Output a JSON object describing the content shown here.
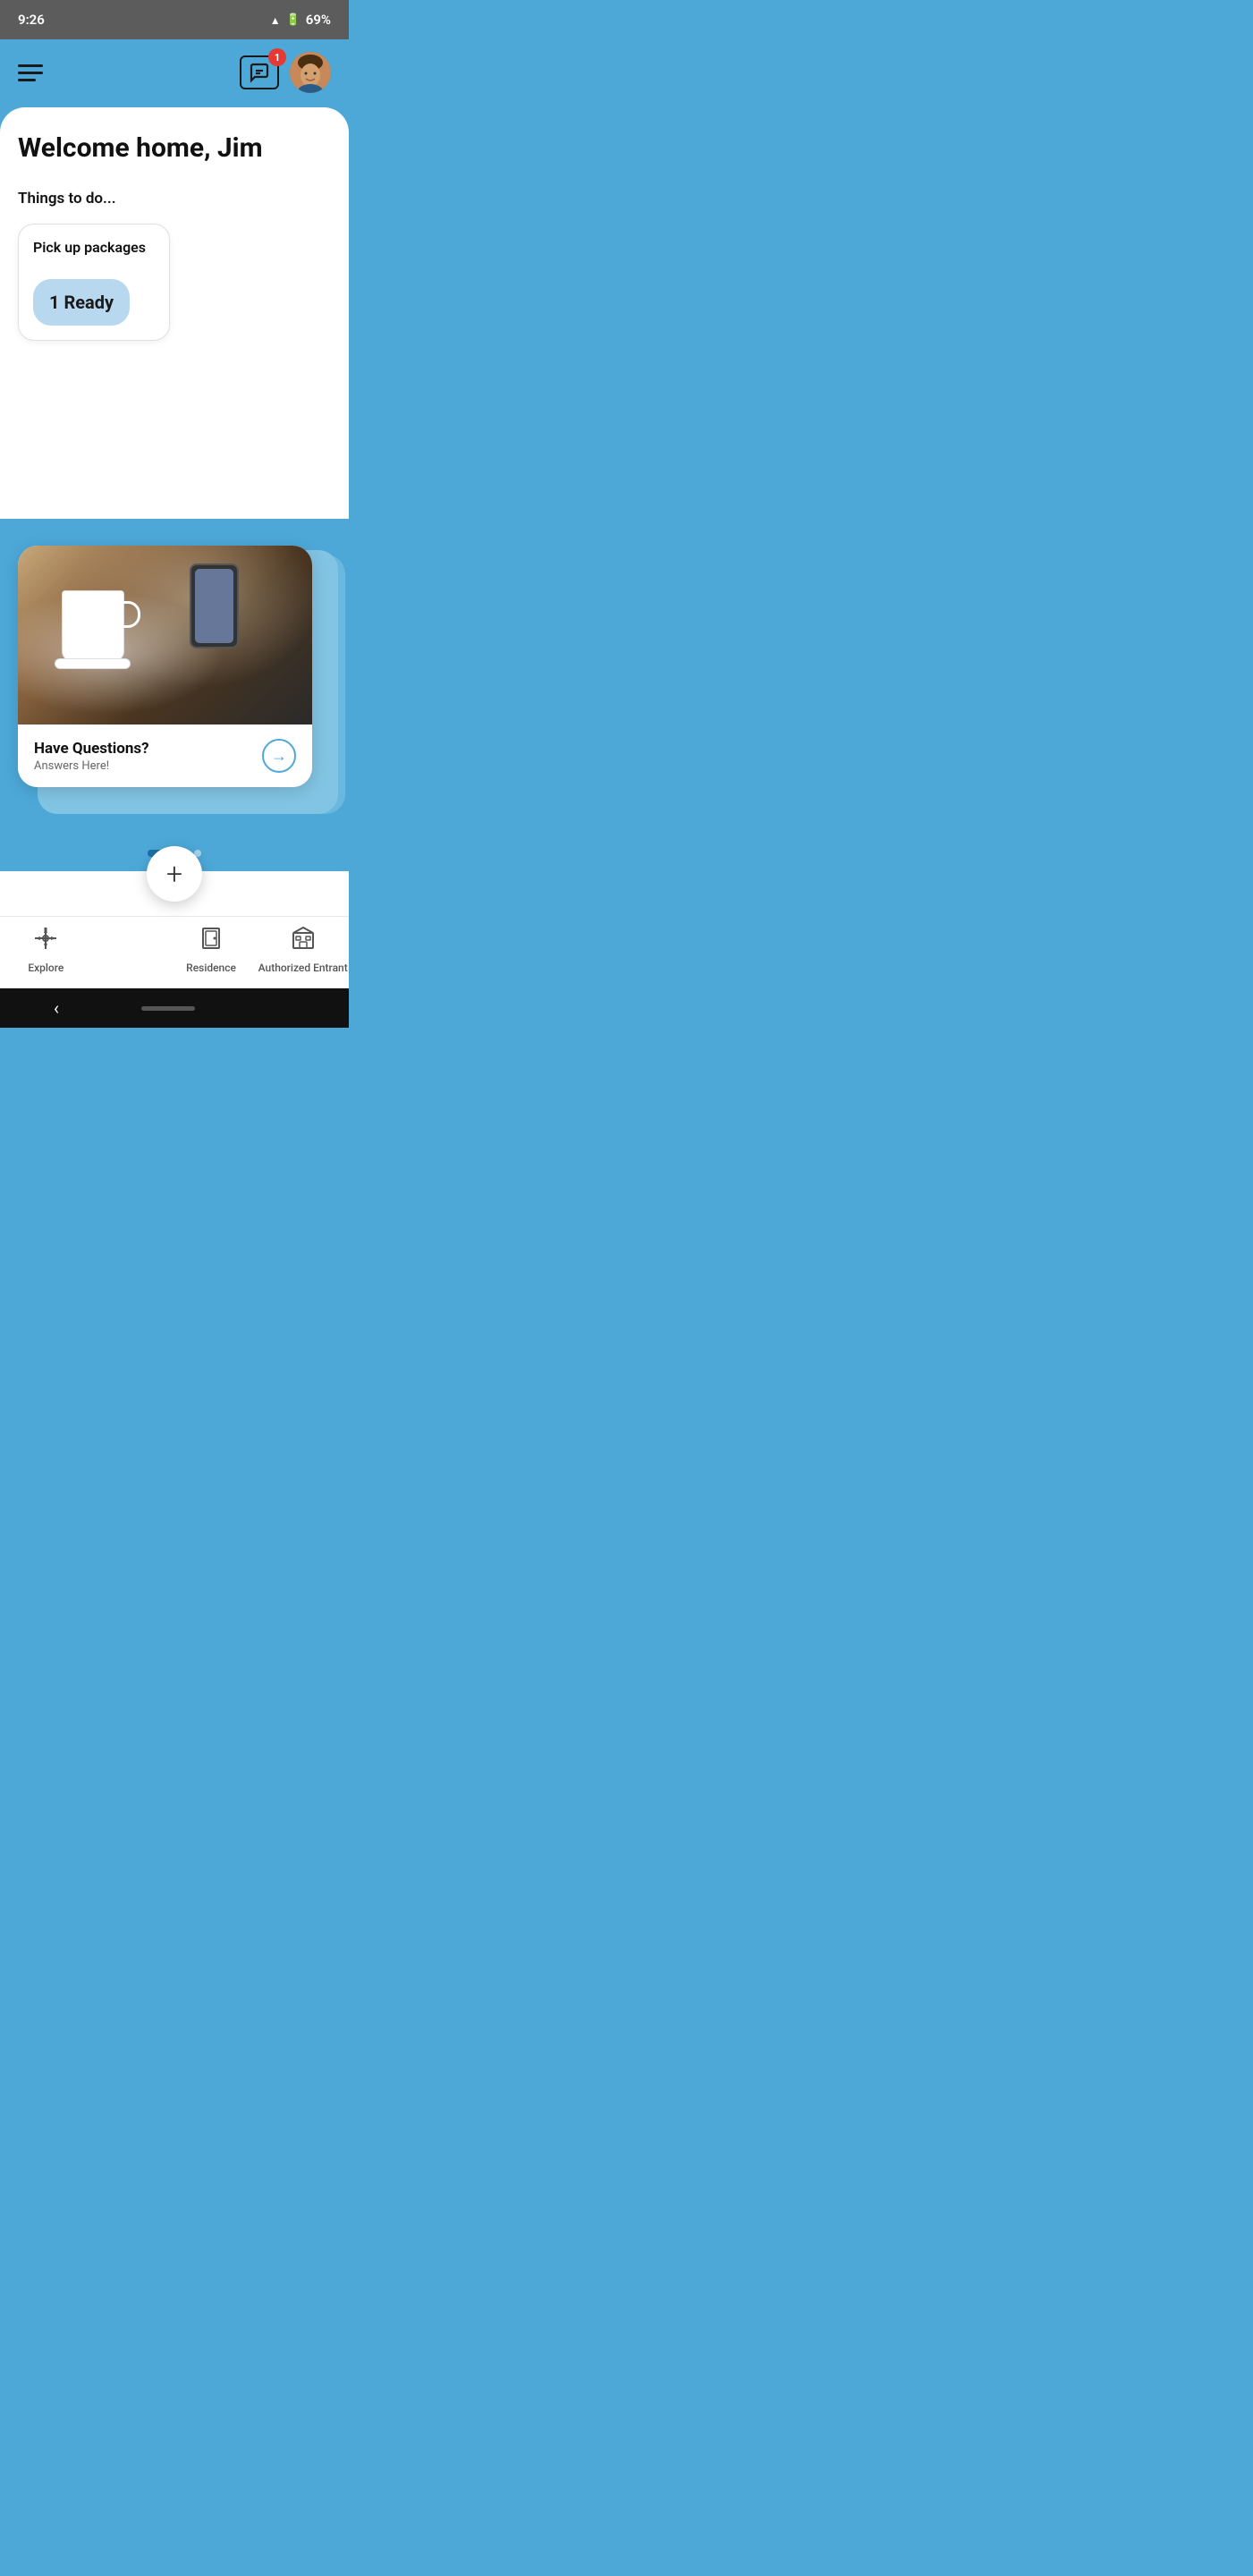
{
  "status": {
    "time": "9:26",
    "battery": "69%"
  },
  "header": {
    "chat_badge": "1",
    "welcome": "Welcome home, Jim"
  },
  "things_to_do": {
    "label": "Things to do...",
    "package_card": {
      "title": "Pick up packages",
      "ready_text": "1 Ready"
    }
  },
  "carousel": {
    "card": {
      "title": "Have Questions?",
      "subtitle": "Answers Here!"
    },
    "dots": [
      {
        "active": true
      },
      {
        "active": false
      },
      {
        "active": false
      }
    ]
  },
  "bottom_nav": {
    "explore_label": "Explore",
    "residence_label": "Residence",
    "authorized_entrant_label": "Authorized Entrant",
    "add_label": "+"
  },
  "system_bar": {
    "back_label": "<"
  }
}
